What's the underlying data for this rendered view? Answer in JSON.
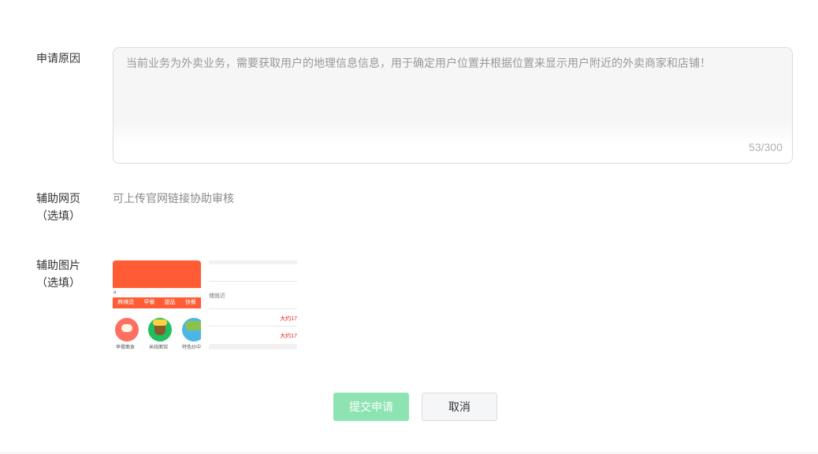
{
  "reason": {
    "label": "申请原因",
    "value": "当前业务为外卖业务，需要获取用户的地理信息信息，用于确定用户位置并根据位置来显示用户附近的外卖商家和店铺！",
    "counter": "53/300"
  },
  "web_page": {
    "label_line1": "辅助网页",
    "label_line2": "（选填）",
    "hint": "可上传官网链接协助审核"
  },
  "images": {
    "label_line1": "辅助图片",
    "label_line2": "（选填）",
    "thumb1": {
      "strip_text": "a",
      "nav": [
        "麻辣烫",
        "早餐",
        "甜品",
        "快餐"
      ],
      "icon_labels": [
        "早餐面食",
        "米线面馆",
        "特色炒中"
      ],
      "icons": [
        "noodle-bowl-icon",
        "burger-icon",
        "salad-bowl-icon"
      ]
    },
    "thumb2": {
      "text_line": "储就近",
      "red1": "大约17",
      "red2": "大约17"
    }
  },
  "buttons": {
    "submit": "提交申请",
    "cancel": "取消"
  },
  "colors": {
    "accent": "#8de4b2",
    "banner": "#ff5c35",
    "price_red": "#e02020"
  }
}
